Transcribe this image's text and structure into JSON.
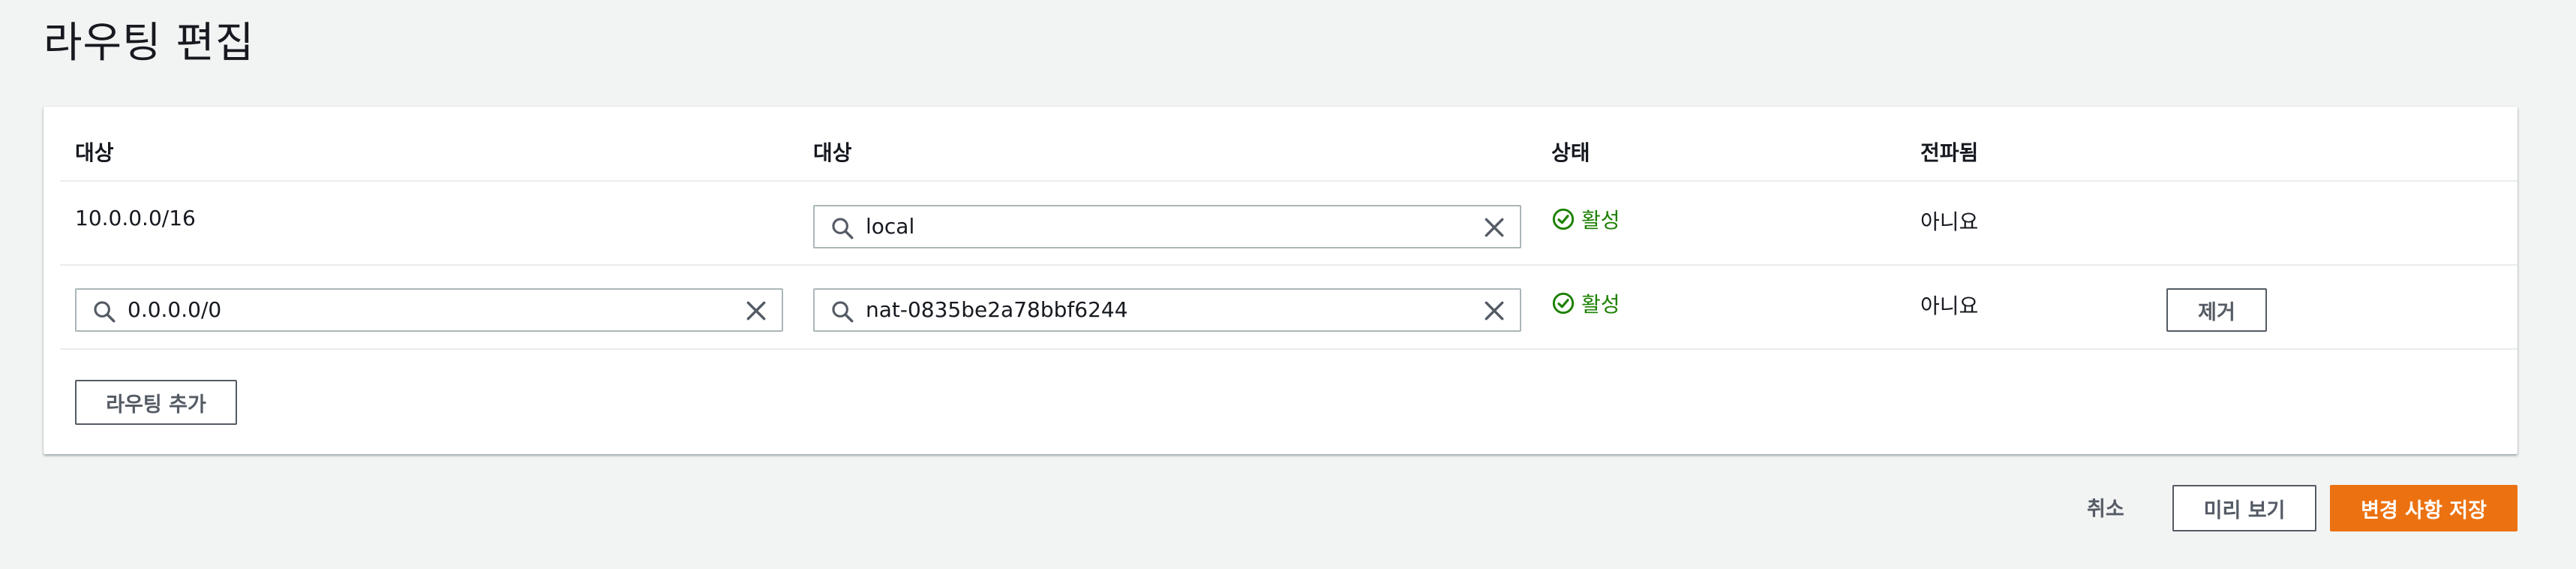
{
  "page": {
    "title": "라우팅 편집"
  },
  "table": {
    "headers": {
      "destination": "대상",
      "target": "대상",
      "status": "상태",
      "propagated": "전파됨"
    },
    "rows": [
      {
        "destination": "10.0.0.0/16",
        "target": "local",
        "status": "활성",
        "propagated": "아니요"
      },
      {
        "destination": "0.0.0.0/0",
        "target": "nat-0835be2a78bbf6244",
        "status": "활성",
        "propagated": "아니요",
        "remove_label": "제거"
      }
    ],
    "add_route_label": "라우팅 추가"
  },
  "footer": {
    "cancel_label": "취소",
    "preview_label": "미리 보기",
    "save_label": "변경 사항 저장"
  },
  "colors": {
    "primary": "#ec7211",
    "success": "#1d8102",
    "background": "#f2f3f3",
    "border": "#aab7b8"
  },
  "icons": [
    "search-icon",
    "clear-icon",
    "status-success-icon"
  ]
}
